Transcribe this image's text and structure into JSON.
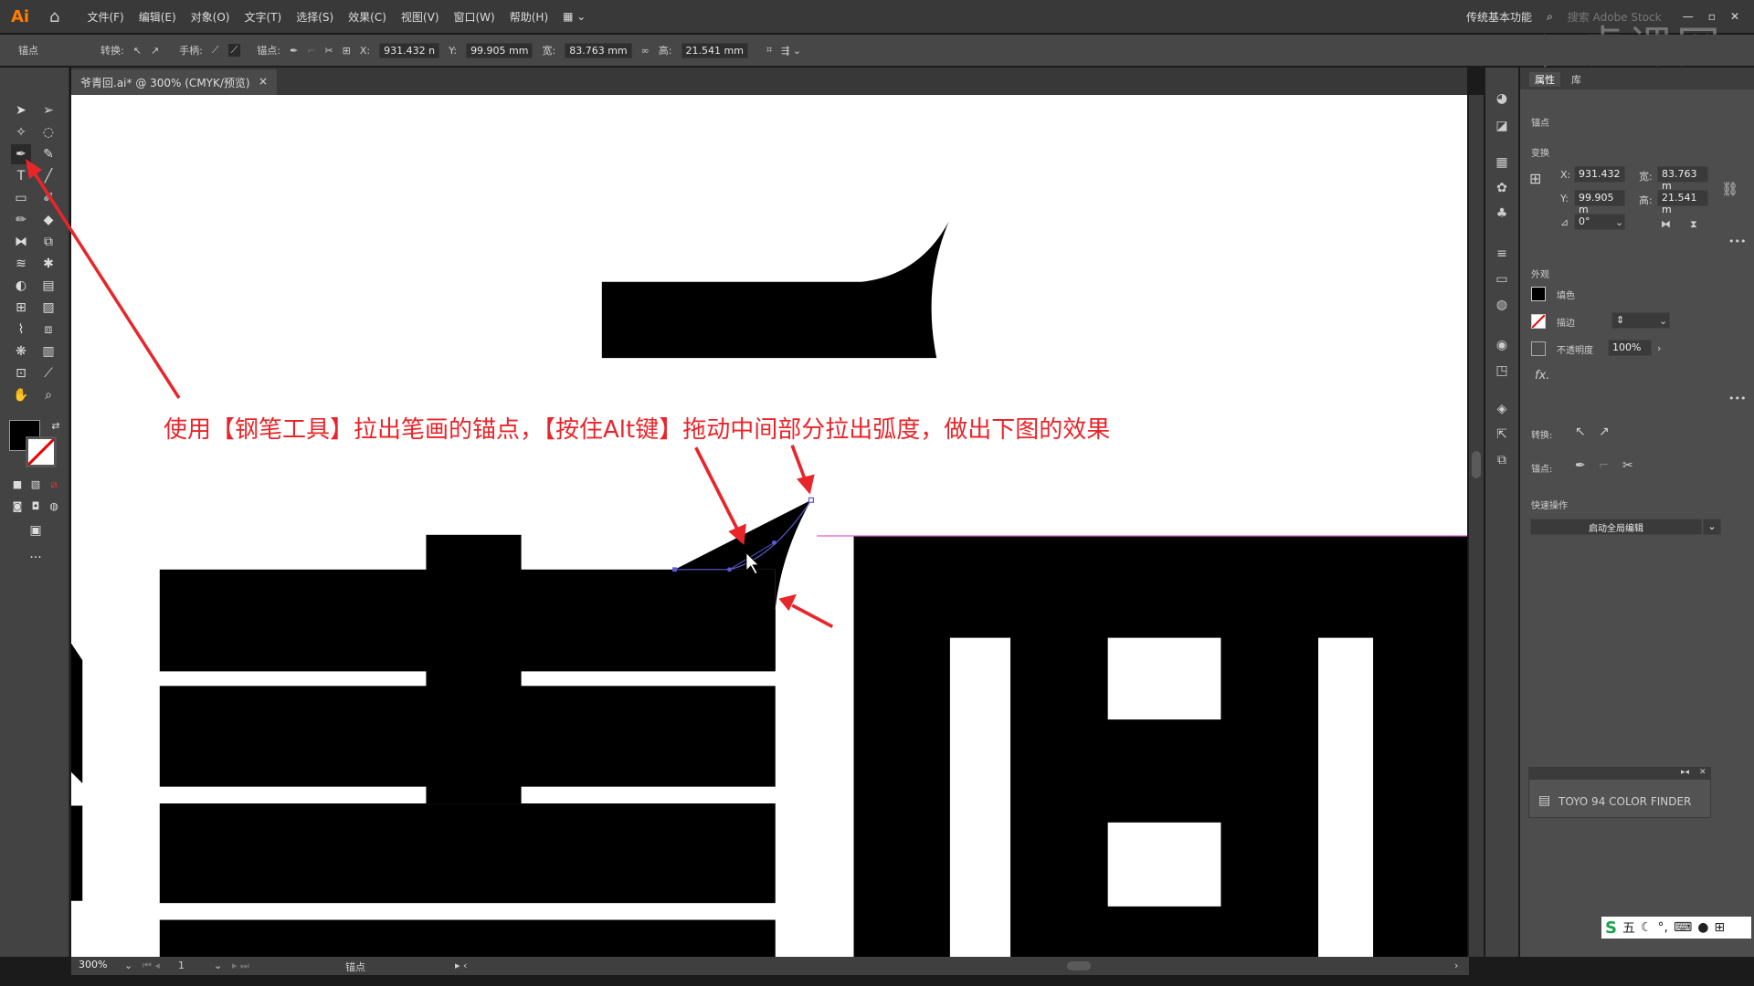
{
  "app": {
    "logo": "Ai",
    "workspace": "传统基本功能",
    "search_placeholder": "搜索 Adobe Stock",
    "watermark": "虎课网"
  },
  "menu": [
    "文件(F)",
    "编辑(E)",
    "对象(O)",
    "文字(T)",
    "选择(S)",
    "效果(C)",
    "视图(V)",
    "窗口(W)",
    "帮助(H)"
  ],
  "control": {
    "mode": "锚点",
    "convert": "转换:",
    "handle": "手柄:",
    "anchor": "锚点:",
    "x_label": "X:",
    "x": "931.432 n",
    "y_label": "Y:",
    "y": "99.905 mm",
    "w_label": "宽:",
    "w": "83.763 mm",
    "h_label": "高:",
    "h": "21.541 mm"
  },
  "document": {
    "tab": "爷青回.ai* @ 300% (CMYK/预览)",
    "close": "×"
  },
  "annotation": "使用【钢笔工具】拉出笔画的锚点，【按住Alt键】拖动中间部分拉出弧度，做出下图的效果",
  "colors": {
    "annotation": "#e8252a",
    "path": "#5b5bd6",
    "guide": "#e05ad0"
  },
  "properties": {
    "tabs": [
      "属性",
      "库"
    ],
    "section_anchor": "锚点",
    "transform": {
      "title": "变换",
      "x_label": "X:",
      "x": "931.432",
      "y_label": "Y:",
      "y": "99.905 m",
      "w_label": "宽:",
      "w": "83.763 m",
      "h_label": "高:",
      "h": "21.541 m",
      "angle": "0°"
    },
    "appearance": {
      "title": "外观",
      "fill": "填色",
      "stroke": "描边",
      "opacity_label": "不透明度",
      "opacity": "100%",
      "fx": "fx."
    },
    "convert": "转换:",
    "anchor": "锚点:",
    "quick": {
      "title": "快速操作",
      "button": "启动全局编辑"
    }
  },
  "float_panel": {
    "item": "TOYO 94 COLOR FINDER"
  },
  "status": {
    "zoom": "300%",
    "artboard": "1",
    "tool": "锚点"
  },
  "ime": {
    "label": "五"
  }
}
